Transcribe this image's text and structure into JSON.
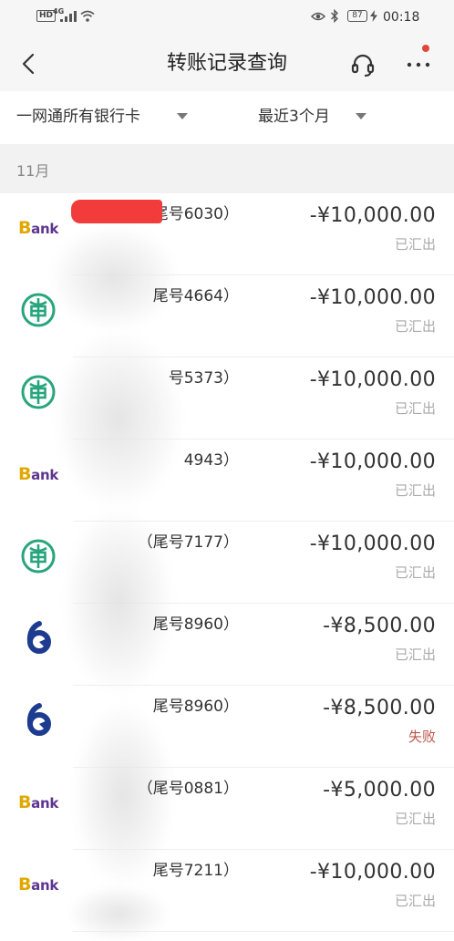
{
  "status_bar": {
    "hd": "HD",
    "network": "4G",
    "battery": "87",
    "time": "00:18",
    "icons": [
      "signal-icon",
      "wifi-icon",
      "eye-icon",
      "bluetooth-icon",
      "battery-icon",
      "charging-icon"
    ]
  },
  "header": {
    "title": "转账记录查询",
    "icons": {
      "back": "chevron-left-icon",
      "service": "headset-icon",
      "more": "more-dots-icon"
    },
    "notification_dot_color": "#e0463a"
  },
  "filters": {
    "card_label": "一网通所有银行卡",
    "period_label": "最近3个月"
  },
  "month_label": "11月",
  "colors": {
    "amount": "#333333",
    "status_sent": "#aaaaaa",
    "status_failed": "#b9574c",
    "redaction": "#f23b3b"
  },
  "records": [
    {
      "logo": "bank-logo-icon",
      "logo_text": "Bank",
      "name": "尾号6030）",
      "amount": "-¥10,000.00",
      "status": "已汇出",
      "status_color": "#aaaaaa"
    },
    {
      "logo": "abc-bank-logo-icon",
      "logo_text": "",
      "name": "尾号4664）",
      "amount": "-¥10,000.00",
      "status": "已汇出",
      "status_color": "#aaaaaa"
    },
    {
      "logo": "abc-bank-logo-icon",
      "logo_text": "",
      "name": "号5373）",
      "amount": "-¥10,000.00",
      "status": "已汇出",
      "status_color": "#aaaaaa"
    },
    {
      "logo": "bank-logo-icon",
      "logo_text": "Bank",
      "name": "4943）",
      "amount": "-¥10,000.00",
      "status": "已汇出",
      "status_color": "#aaaaaa"
    },
    {
      "logo": "abc-bank-logo-icon",
      "logo_text": "",
      "name": "（尾号7177）",
      "amount": "-¥10,000.00",
      "status": "已汇出",
      "status_color": "#aaaaaa"
    },
    {
      "logo": "navy-bank-logo-icon",
      "logo_text": "",
      "name": "尾号8960）",
      "amount": "-¥8,500.00",
      "status": "已汇出",
      "status_color": "#aaaaaa"
    },
    {
      "logo": "navy-bank-logo-icon",
      "logo_text": "",
      "name": "尾号8960）",
      "amount": "-¥8,500.00",
      "status": "失败",
      "status_color": "#b9574c"
    },
    {
      "logo": "bank-logo-icon",
      "logo_text": "Bank",
      "name": "（尾号0881）",
      "amount": "-¥5,000.00",
      "status": "已汇出",
      "status_color": "#aaaaaa"
    },
    {
      "logo": "bank-logo-icon",
      "logo_text": "Bank",
      "name": "尾号7211）",
      "amount": "-¥10,000.00",
      "status": "已汇出",
      "status_color": "#aaaaaa"
    }
  ]
}
